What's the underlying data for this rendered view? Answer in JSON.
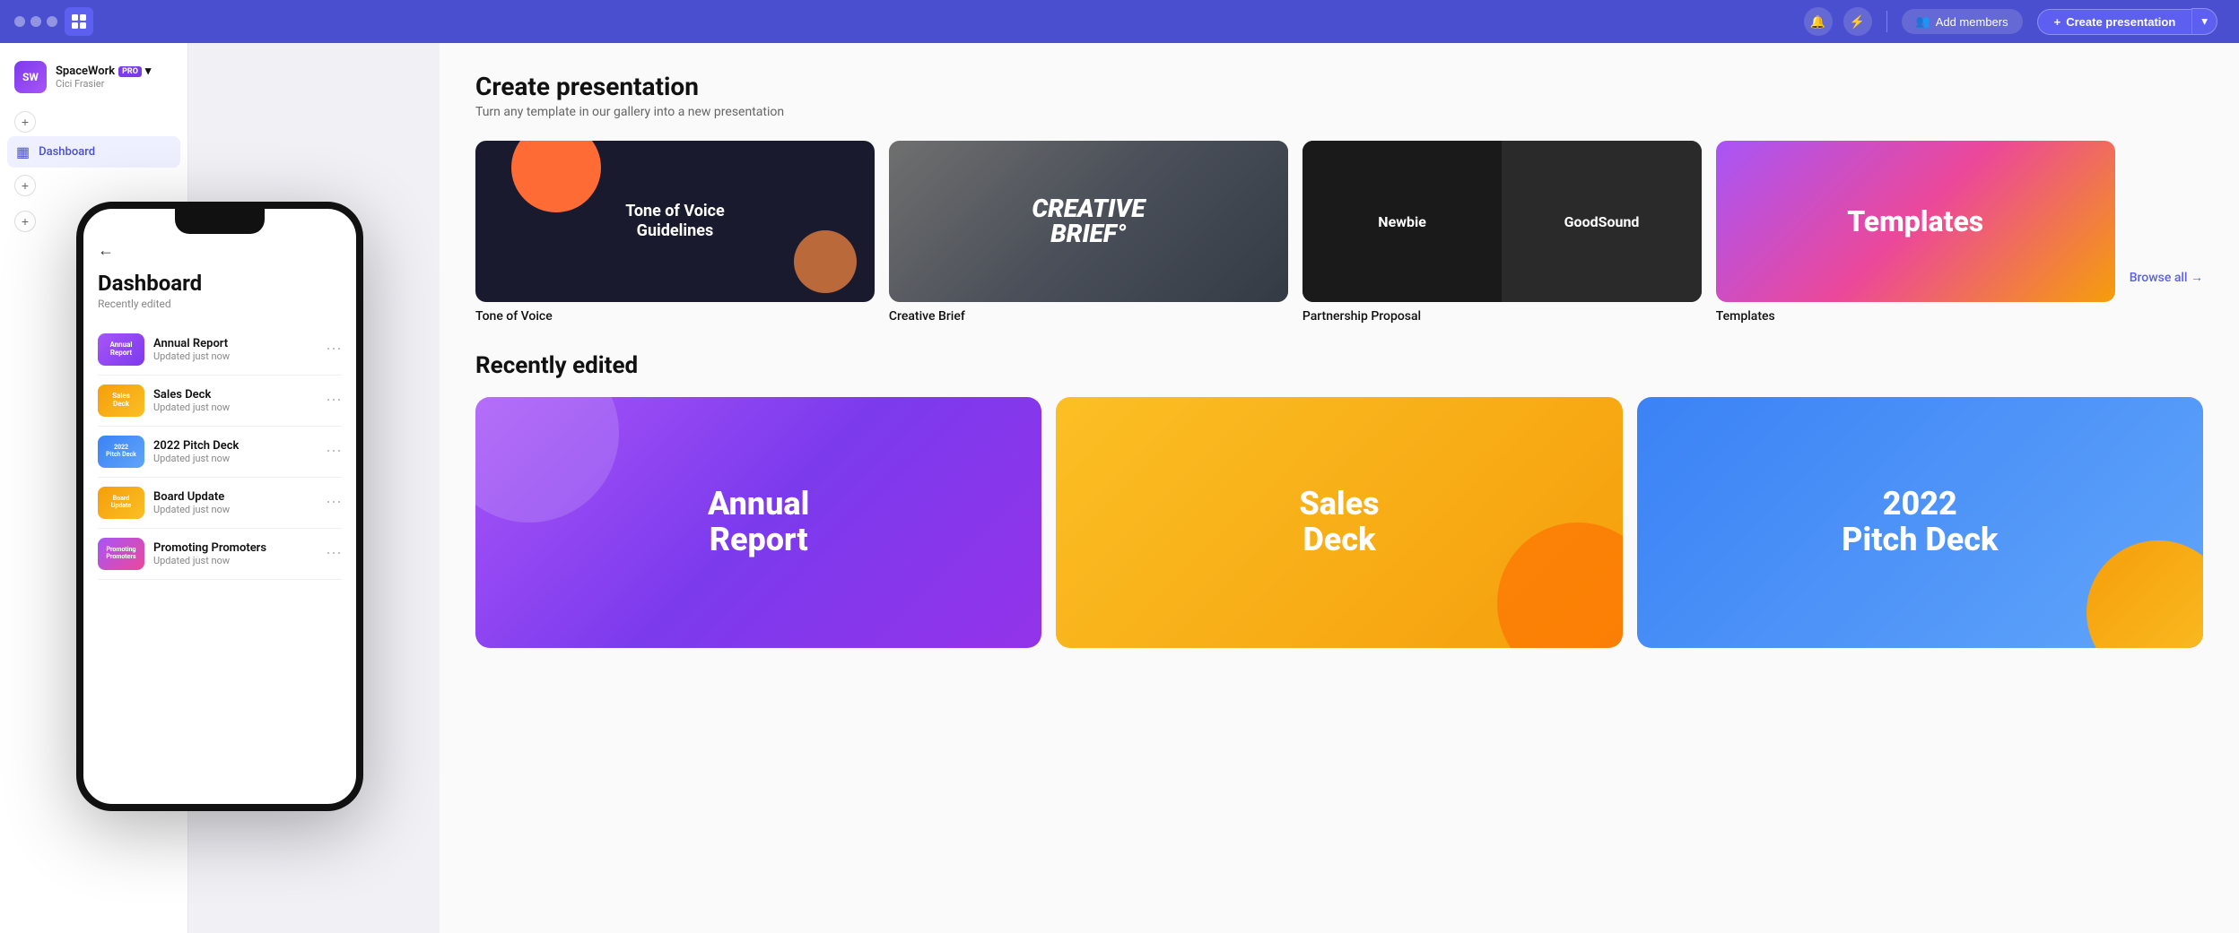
{
  "topbar": {
    "window_controls": [
      "",
      "",
      ""
    ],
    "app_icon": "grid-icon",
    "workspace": {
      "name": "SpaceWork",
      "badge": "PRO",
      "user": "Cici Frasier"
    },
    "notifications_icon": "bell-icon",
    "lightning_icon": "lightning-icon",
    "add_members_label": "Add members",
    "create_label": "Create presentation"
  },
  "sidebar": {
    "dashboard_label": "Dashboard",
    "add_tooltip": "Add"
  },
  "phone": {
    "back_icon": "←",
    "title": "Dashboard",
    "subtitle": "Recently edited",
    "items": [
      {
        "name": "Annual Report",
        "time": "Updated just now",
        "thumb": "annual"
      },
      {
        "name": "Sales Deck",
        "time": "Updated just now",
        "thumb": "sales"
      },
      {
        "name": "2022 Pitch Deck",
        "time": "Updated just now",
        "thumb": "pitch"
      },
      {
        "name": "Board Update",
        "time": "Updated just now",
        "thumb": "board"
      },
      {
        "name": "Promoting Promoters",
        "time": "Updated just now",
        "thumb": "promoting"
      }
    ]
  },
  "main": {
    "create_title": "Create presentation",
    "create_subtitle": "Turn any template in our gallery into a new presentation",
    "templates": [
      {
        "id": "tone",
        "label": "Tone of Voice",
        "text": "Tone of Voice Guidelines"
      },
      {
        "id": "creative",
        "label": "Creative Brief",
        "text": "CREATIVE BRIEF°"
      },
      {
        "id": "partnership",
        "label": "Partnership Proposal",
        "left": "Newbie",
        "right": "GoodSound"
      },
      {
        "id": "templates",
        "label": "Templates",
        "text": "Templates"
      }
    ],
    "browse_all": "Browse all →",
    "recently_title": "Recently edited",
    "recent_items": [
      {
        "id": "annual",
        "text": "Annual Report"
      },
      {
        "id": "sales",
        "text": "Sales Deck"
      },
      {
        "id": "pitch",
        "text": "2022 Pitch Deck"
      }
    ]
  }
}
